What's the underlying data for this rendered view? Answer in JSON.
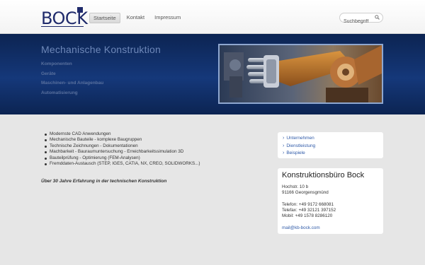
{
  "brand": {
    "logo_text": "BOCK"
  },
  "nav": {
    "items": [
      {
        "label": "Startseite",
        "active": true
      },
      {
        "label": "Kontakt",
        "active": false
      },
      {
        "label": "Impressum",
        "active": false
      }
    ]
  },
  "search": {
    "placeholder": "Suchbegriff",
    "icon": "search-icon"
  },
  "banner": {
    "title": "Mechanische Konstruktion",
    "links": [
      "Komponenten",
      "Geräte",
      "Maschinen- und Anlagenbau",
      "Automatisierung"
    ]
  },
  "features": [
    "Modernste CAD Anwendungen",
    "Mechanische Bauteile - komplexe Baugruppen",
    "Technische Zeichnungen - Dokumentationen",
    "Machbarkeit - Bauraumuntersuchung - Erreichbarkeitssimulation 3D",
    "Bauteilprüfung - Optimierung  (FEM-Analysen)",
    "Fremddaten-Austausch (STEP, IGES, CATIA, NX, CREO, SOLIDWORKS...)"
  ],
  "tagline": "Über 30 Jahre Erfahrung in der technischen Konstruktion",
  "sidebar": {
    "links": [
      "Unternehmen",
      "Dienstleistung",
      "Beispiele"
    ]
  },
  "contact": {
    "title": "Konstruktionsbüro Bock",
    "street": "Hochstr. 10 b",
    "city": "91166 Georgensgmünd",
    "phone": "Telefon: +49 9172 668081",
    "fax": "Telefax: +49 32121 397152",
    "mobile": "Mobil: +49 1578 8286120",
    "email": "mail@kb-bock.com"
  },
  "colors": {
    "brand_blue": "#1f2a6b",
    "banner_dark": "#0c2452",
    "link_blue": "#2f5aa8",
    "page_bg": "#e6e6e6"
  }
}
